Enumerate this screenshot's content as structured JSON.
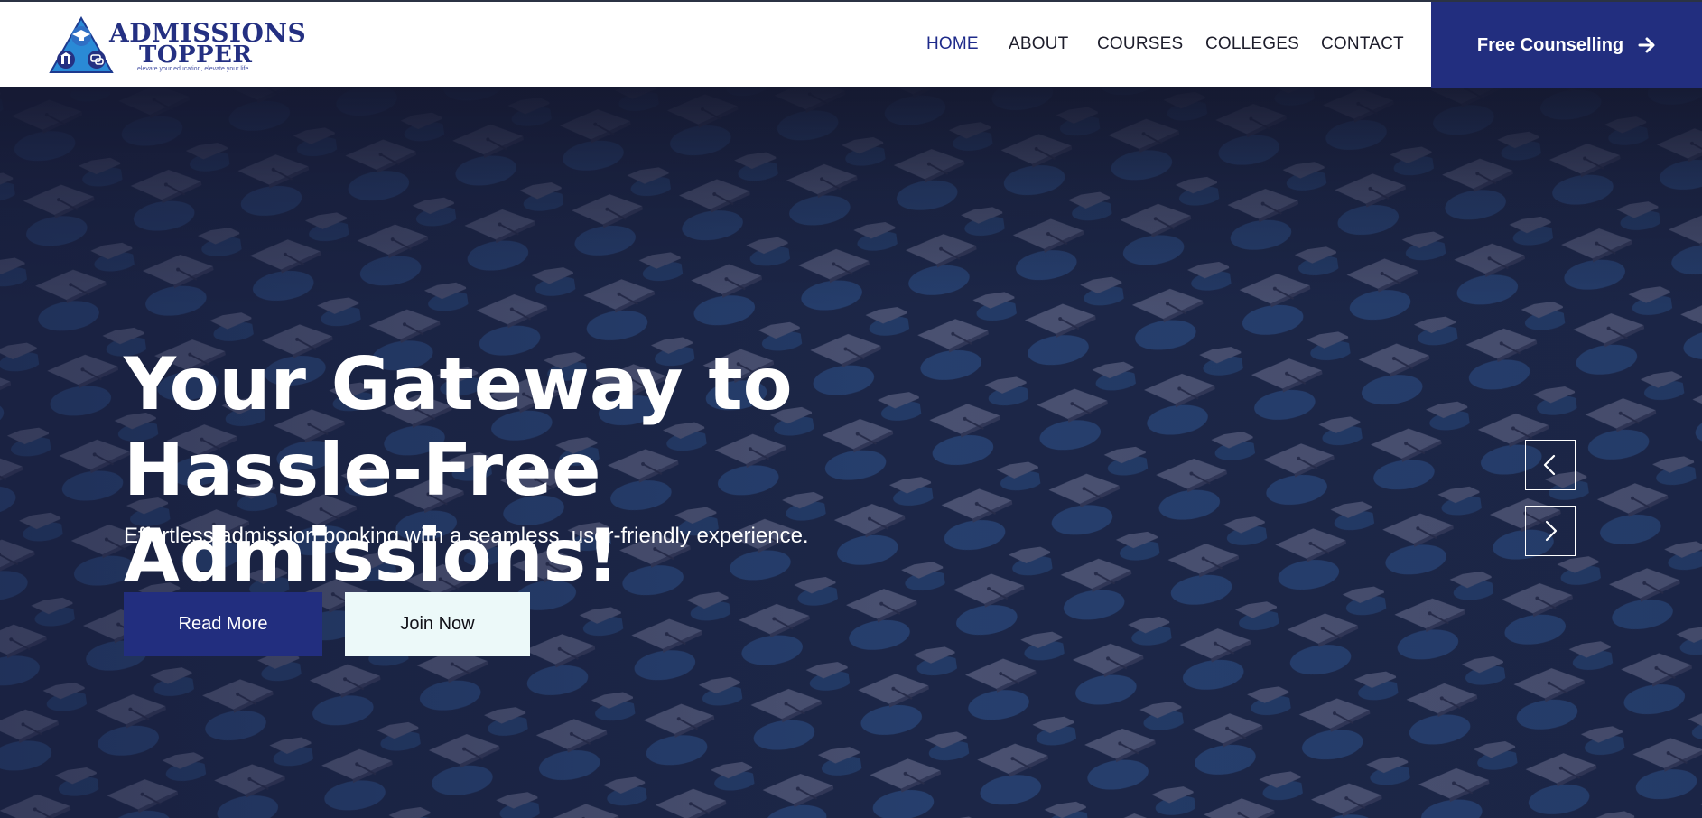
{
  "brand": {
    "name_line1": "ADMISSIONS",
    "name_line2": "TOPPER",
    "tagline": "elevate your education, elevate your life",
    "primary_color": "#222e7f",
    "accent_color": "#2a8ad6"
  },
  "nav": {
    "items": [
      {
        "label": "HOME",
        "active": true
      },
      {
        "label": "ABOUT",
        "active": false
      },
      {
        "label": "COURSES",
        "active": false
      },
      {
        "label": "COLLEGES",
        "active": false
      },
      {
        "label": "CONTACT",
        "active": false
      }
    ],
    "cta_label": "Free Counselling",
    "cta_icon": "arrow-right-icon"
  },
  "hero": {
    "title": "Your Gateway to Hassle-Free Admissions!",
    "subtitle": "Effortless admission booking with a seamless, user-friendly experience.",
    "primary_button": "Read More",
    "secondary_button": "Join Now",
    "background": "graduation-caps-photo",
    "prev_icon": "chevron-left-icon",
    "next_icon": "chevron-right-icon"
  }
}
